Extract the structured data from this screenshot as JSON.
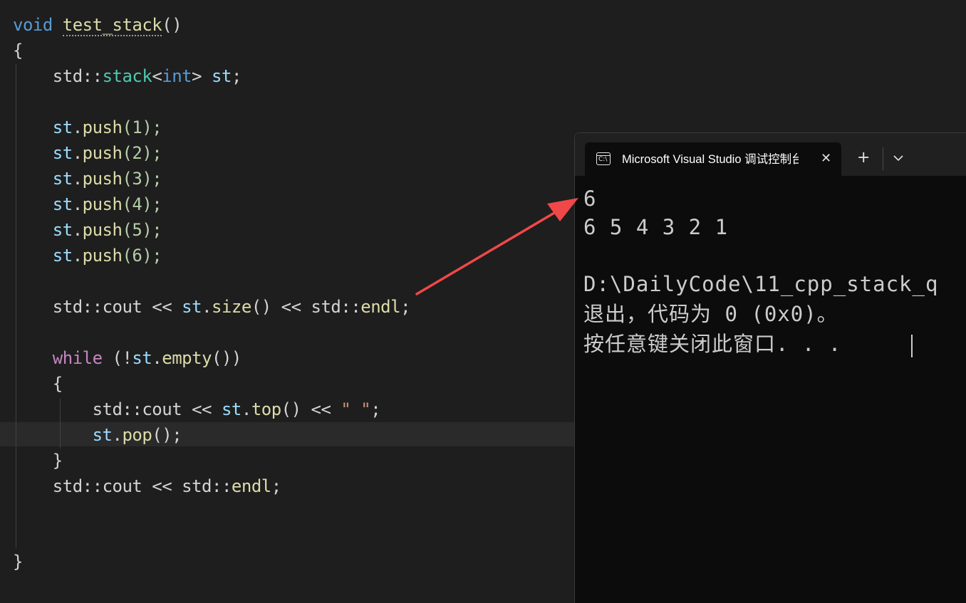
{
  "editor": {
    "code": {
      "l1_kw": "void",
      "l1_fn": "test_stack",
      "l1_paren": "()",
      "l2_brace": "{",
      "l3_std": "std",
      "l3_sep": "::",
      "l3_stack": "stack",
      "l3_lt": "<",
      "l3_int": "int",
      "l3_gt": ">",
      "l3_st": "st",
      "l3_semi": ";",
      "push_obj": "st",
      "push_dot": ".",
      "push_fn": "push",
      "push_args": [
        "(1);",
        "(2);",
        "(3);",
        "(4);",
        "(5);",
        "(6);"
      ],
      "cout1_std": "std",
      "cout1_sep": "::",
      "cout1_cout": "cout",
      "cout1_op": " << ",
      "cout1_st": "st",
      "cout1_dot": ".",
      "cout1_size": "size",
      "cout1_paren": "()",
      "cout1_op2": " << ",
      "cout1_std2": "std",
      "cout1_sep2": "::",
      "cout1_endl": "endl",
      "cout1_semi": ";",
      "while_kw": "while",
      "while_open": " (!",
      "while_st": "st",
      "while_dot": ".",
      "while_empty": "empty",
      "while_close": "())",
      "wbrace_open": "{",
      "cout2_std": "std",
      "cout2_sep": "::",
      "cout2_cout": "cout",
      "cout2_op": " << ",
      "cout2_st": "st",
      "cout2_dot": ".",
      "cout2_top": "top",
      "cout2_paren": "()",
      "cout2_op2": " << ",
      "cout2_str": "\" \"",
      "cout2_semi": ";",
      "pop_st": "st",
      "pop_dot": ".",
      "pop_fn": "pop",
      "pop_paren": "();",
      "wbrace_close": "}",
      "cout3_std": "std",
      "cout3_sep": "::",
      "cout3_cout": "cout",
      "cout3_op": " << ",
      "cout3_std2": "std",
      "cout3_sep2": "::",
      "cout3_endl": "endl",
      "cout3_semi": ";",
      "end_brace": "}"
    }
  },
  "terminal": {
    "tab_title": "Microsoft Visual Studio 调试控制台",
    "tab_icon_glyph": "C:\\",
    "close_glyph": "✕",
    "new_tab_glyph": "+",
    "output": [
      "6",
      "6 5 4 3 2 1",
      "",
      "D:\\DailyCode\\11_cpp_stack_q",
      "退出，代码为 0 (0x0)。",
      "按任意键关闭此窗口. . ."
    ]
  },
  "colors": {
    "editor_bg": "#1e1e1e",
    "keyword": "#569cd6",
    "control_keyword": "#c586c0",
    "function": "#dcdcaa",
    "type": "#4ec9b0",
    "variable": "#9cdcfe",
    "number": "#b5cea8",
    "string": "#ce9178",
    "terminal_bg": "#0c0c0c",
    "annotation_arrow": "#f04848"
  }
}
